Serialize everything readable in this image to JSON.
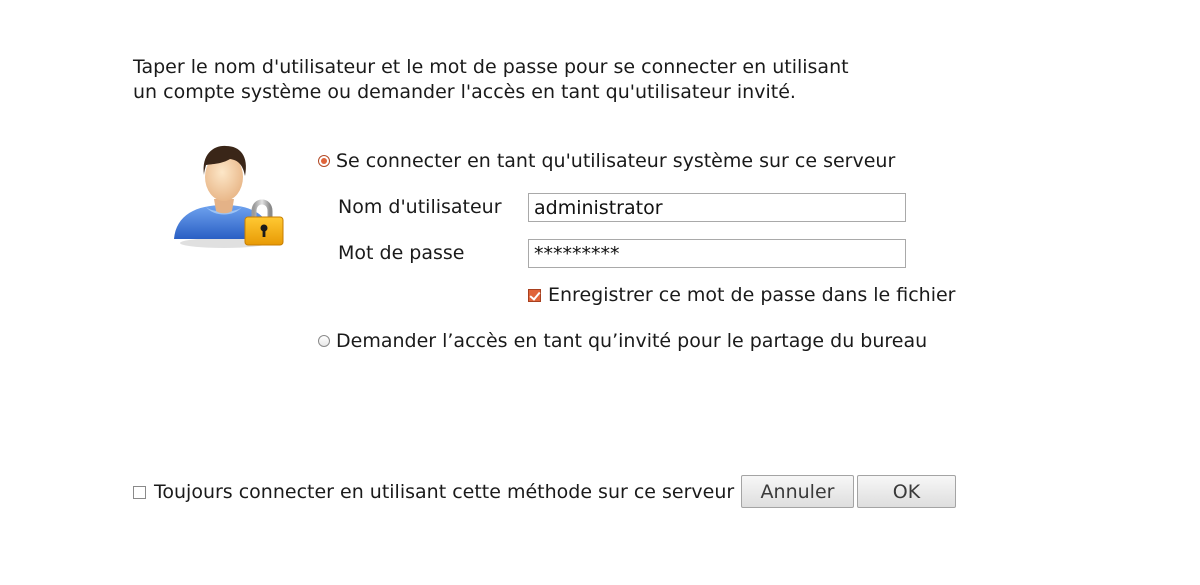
{
  "instructions": {
    "line1": "Taper le nom d'utilisateur et le mot de passe pour se connecter en utilisant",
    "line2": "un compte système ou demander l'accès en tant qu'utilisateur invité."
  },
  "icon": "user-with-padlock-icon",
  "options": {
    "system_user": {
      "label": "Se connecter en tant qu'utilisateur système sur ce serveur",
      "selected": true
    },
    "guest": {
      "label": "Demander l’accès en tant qu’invité pour le partage du bureau",
      "selected": false
    }
  },
  "fields": {
    "username": {
      "label": "Nom d'utilisateur",
      "value": "administrator"
    },
    "password": {
      "label": "Mot de passe",
      "value": "*********"
    }
  },
  "save_password": {
    "label": "Enregistrer ce mot de passe dans le fichier",
    "checked": true
  },
  "always_use_method": {
    "label": "Toujours connecter en utilisant cette méthode sur ce serveur",
    "checked": false
  },
  "buttons": {
    "cancel": "Annuler",
    "ok": "OK"
  },
  "colors": {
    "accent": "#e0643a",
    "button_text": "#3a3a3a"
  }
}
